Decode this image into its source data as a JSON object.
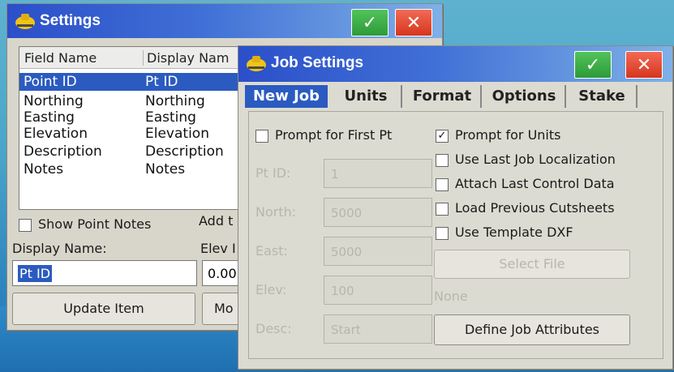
{
  "colors": {
    "titlebar_start": "#2b4fc9",
    "selection": "#2b5bc0",
    "ok": "#2e9a3a",
    "close": "#d6361e"
  },
  "settings": {
    "title": "Settings",
    "columns": [
      "Field Name",
      "Display Nam"
    ],
    "rows": [
      {
        "field": "Point ID",
        "display": "Pt ID"
      },
      {
        "field": "Northing",
        "display": "Northing"
      },
      {
        "field": "Easting",
        "display": "Easting"
      },
      {
        "field": "Elevation",
        "display": "Elevation"
      },
      {
        "field": "Description",
        "display": "Description"
      },
      {
        "field": "Notes",
        "display": "Notes"
      }
    ],
    "show_point_notes_label": "Show Point Notes",
    "add_label": "Add t",
    "display_name_label": "Display Name:",
    "display_name_value": "Pt ID",
    "elev_label": "Elev I",
    "elev_value": "0.00",
    "update_button": "Update Item",
    "mo_button": "Mo"
  },
  "job": {
    "title": "Job Settings",
    "tabs": [
      "New Job",
      "Units",
      "Format",
      "Options",
      "Stake"
    ],
    "prompt_first_pt": "Prompt for First Pt",
    "fields": [
      {
        "label": "Pt ID:",
        "value": "1"
      },
      {
        "label": "North:",
        "value": "5000"
      },
      {
        "label": "East:",
        "value": "5000"
      },
      {
        "label": "Elev:",
        "value": "100"
      },
      {
        "label": "Desc:",
        "value": "Start"
      }
    ],
    "options": [
      {
        "label": "Prompt for Units",
        "checked": true
      },
      {
        "label": "Use Last Job Localization",
        "checked": false
      },
      {
        "label": "Attach Last Control Data",
        "checked": false
      },
      {
        "label": "Load Previous Cutsheets",
        "checked": false
      },
      {
        "label": "Use Template DXF",
        "checked": false
      }
    ],
    "select_file_button": "Select File",
    "none_text": "None",
    "define_attributes_button": "Define Job Attributes"
  }
}
